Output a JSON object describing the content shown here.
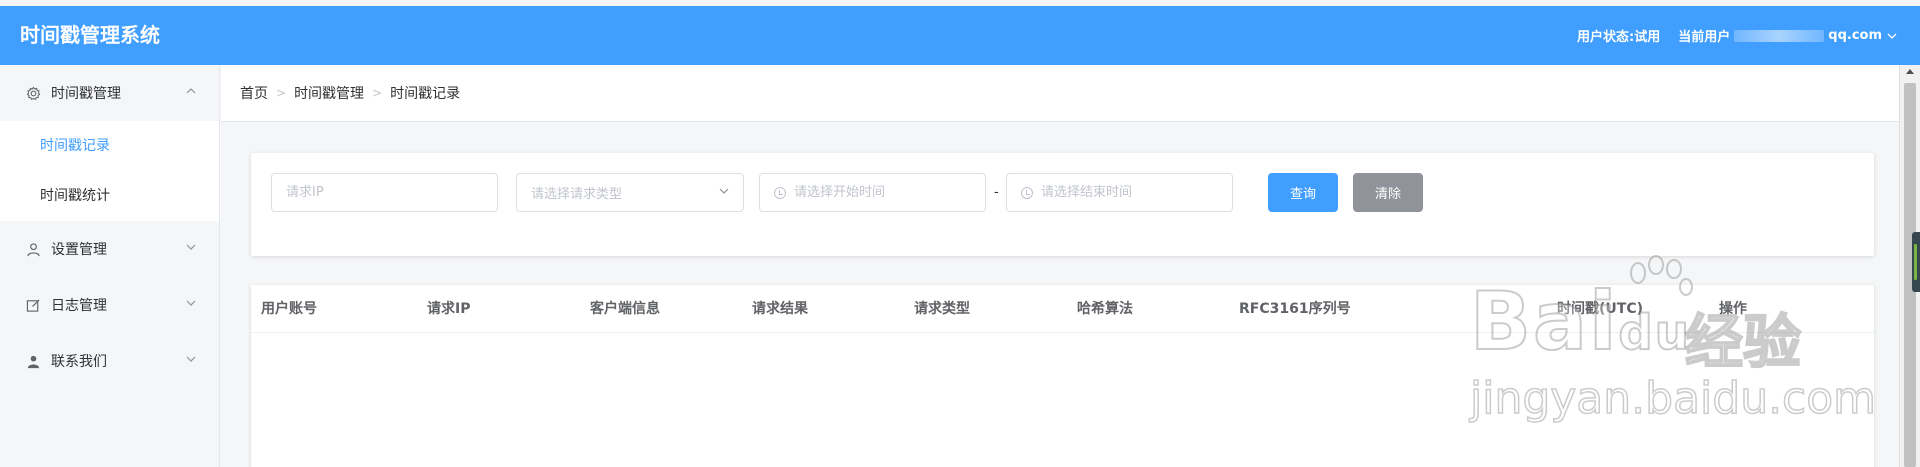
{
  "header": {
    "title": "时间戳管理系统",
    "user_status": "用户状态:试用",
    "current_user_label": "当前用户",
    "user_email_suffix": "qq.com"
  },
  "sidebar": {
    "groups": [
      {
        "label": "时间戳管理",
        "icon": "gear-icon",
        "expanded": true,
        "items": [
          {
            "label": "时间戳记录",
            "active": true
          },
          {
            "label": "时间戳统计",
            "active": false
          }
        ]
      },
      {
        "label": "设置管理",
        "icon": "user-icon",
        "expanded": false
      },
      {
        "label": "日志管理",
        "icon": "edit-icon",
        "expanded": false
      },
      {
        "label": "联系我们",
        "icon": "person-icon",
        "expanded": false
      }
    ]
  },
  "breadcrumb": [
    "首页",
    "时间戳管理",
    "时间戳记录"
  ],
  "search": {
    "ip_placeholder": "请求IP",
    "type_placeholder": "请选择请求类型",
    "start_placeholder": "请选择开始时间",
    "range_separator": "-",
    "end_placeholder": "请选择结束时间",
    "query_label": "查询",
    "clear_label": "清除"
  },
  "table": {
    "columns": [
      "用户账号",
      "请求IP",
      "客户端信息",
      "请求结果",
      "请求类型",
      "哈希算法",
      "RFC3161序列号",
      "时间戳(UTC)",
      "操作"
    ],
    "rows": []
  },
  "watermark": {
    "brand": "Bai",
    "brand_tail": "du",
    "cn": "经验",
    "url": "jingyan.baidu.com"
  },
  "colors": {
    "primary": "#409eff",
    "gray_button": "#909399",
    "background": "#f5f6f7"
  }
}
